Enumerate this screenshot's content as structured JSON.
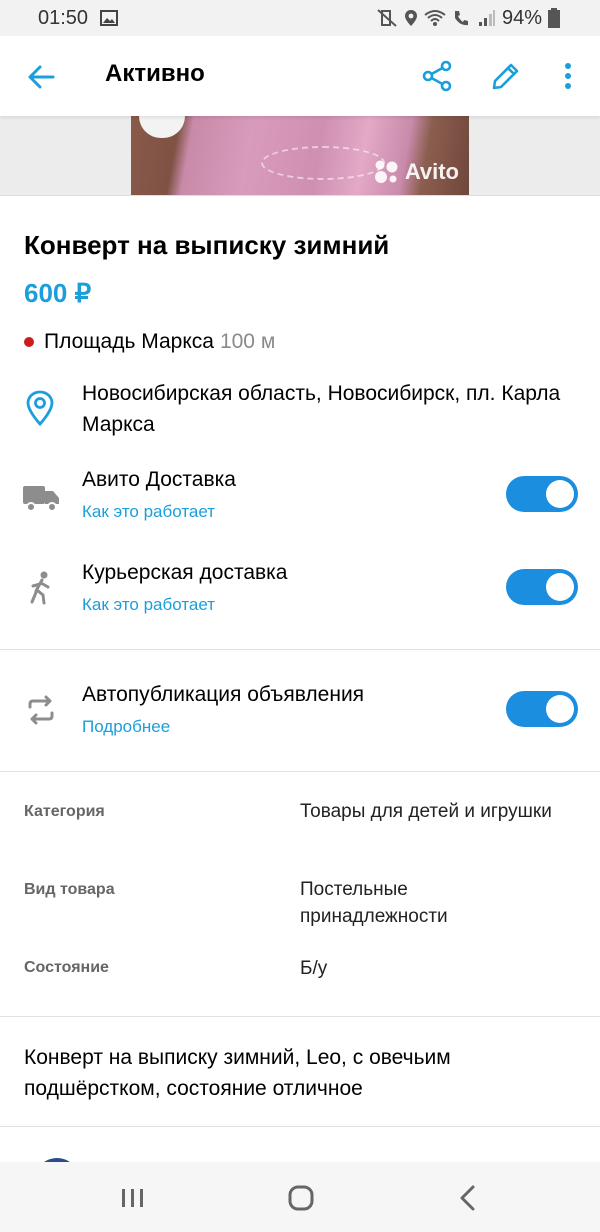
{
  "status_bar": {
    "time": "01:50",
    "battery": "94%"
  },
  "toolbar": {
    "title": "Активно",
    "icons": [
      "back-arrow-icon",
      "share-icon",
      "edit-pencil-icon",
      "more-vert-icon"
    ]
  },
  "photo": {
    "watermark": "Avito"
  },
  "ad": {
    "title": "Конверт на выписку зимний",
    "price": "600 ₽",
    "metro_station": "Площадь Маркса",
    "metro_distance": "100 м",
    "address": "Новосибирская область, Новосибирск, пл. Карла Маркса"
  },
  "options": [
    {
      "title": "Авито Доставка",
      "link": "Как это работает",
      "enabled": true,
      "icon": "truck-icon"
    },
    {
      "title": "Курьерская доставка",
      "link": "Как это работает",
      "enabled": true,
      "icon": "walker-icon"
    },
    {
      "title": "Автопубликация объявления",
      "link": "Подробнее",
      "enabled": true,
      "icon": "repeat-icon"
    }
  ],
  "params": [
    {
      "label": "Категория",
      "value": "Товары для детей и игрушки"
    },
    {
      "label": "Вид товара",
      "value": "Постельные принадлежности"
    },
    {
      "label": "Состояние",
      "value": "Б/у"
    }
  ],
  "description": "Конверт на выписку зимний, Leo, с овечьим подшёрстком, состояние отличное",
  "colors": {
    "accent": "#1a9fdc",
    "toggle_on": "#1c8ee0",
    "metro_dot": "#cc1d1d"
  }
}
